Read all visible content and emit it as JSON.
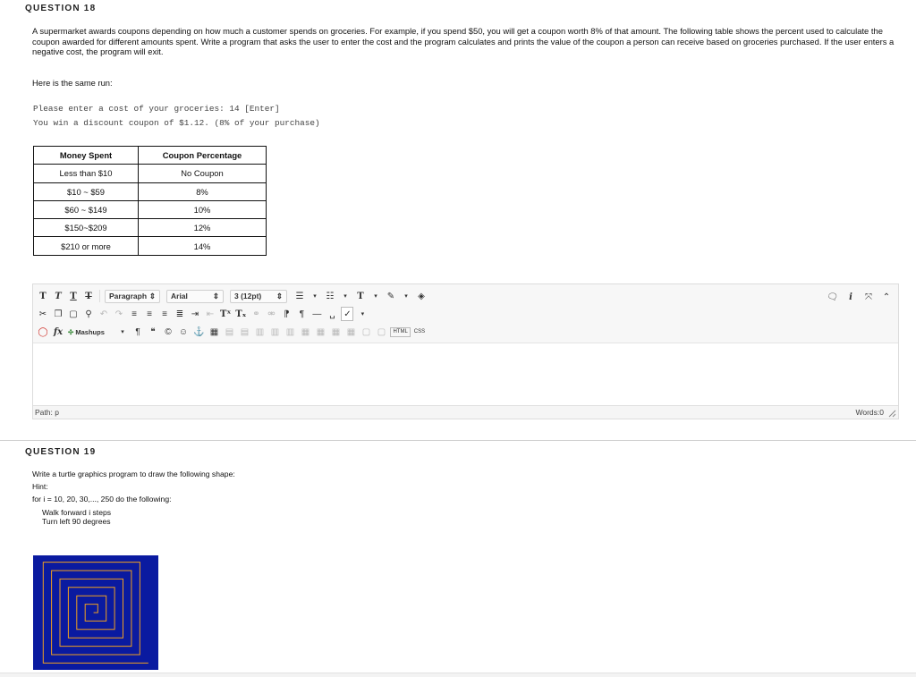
{
  "question18": {
    "header": "QUESTION 18",
    "description": "A supermarket awards coupons depending on how much a customer spends on groceries. For example, if you spend $50, you will get a coupon worth 8% of that amount. The following table shows the percent used to calculate the coupon awarded for different amounts spent. Write a program that asks the user to enter the cost and the program calculates and prints the value of the coupon a person can receive based on groceries purchased. If the user enters a negative cost, the program will exit.",
    "same_run_label": "Here is the same run:",
    "sample_run": [
      "Please enter a cost of your groceries: 14 [Enter]",
      "You win a discount coupon of $1.12. (8% of your purchase)"
    ],
    "table": {
      "headers": [
        "Money Spent",
        "Coupon Percentage"
      ],
      "rows": [
        [
          "Less than $10",
          "No Coupon"
        ],
        [
          "$10 ~ $59",
          "8%"
        ],
        [
          "$60 ~ $149",
          "10%"
        ],
        [
          "$150~$209",
          "12%"
        ],
        [
          "$210 or more",
          "14%"
        ]
      ]
    },
    "editor": {
      "toolbar": {
        "paragraph_select": "Paragraph",
        "font_select": "Arial",
        "size_select": "3 (12pt)",
        "mashups_label": "Mashups",
        "html_label": "HTML",
        "css_label": "CSS"
      },
      "content": "",
      "path_label": "Path: p",
      "words_label": "Words:0"
    }
  },
  "question19": {
    "header": "QUESTION 19",
    "prompt": "Write a turtle graphics program to draw the following shape:",
    "hint_label": "Hint:",
    "loop_line": "for i = 10, 20, 30,..., 250 do the following:",
    "steps": [
      "Walk forward i steps",
      "Turn left 90 degrees"
    ],
    "figure": {
      "background_color": "#0a1aa0",
      "line_color": "#f0a020",
      "step_start": 10,
      "step_end": 250,
      "step_increment": 10,
      "turn_degrees": 90
    }
  }
}
